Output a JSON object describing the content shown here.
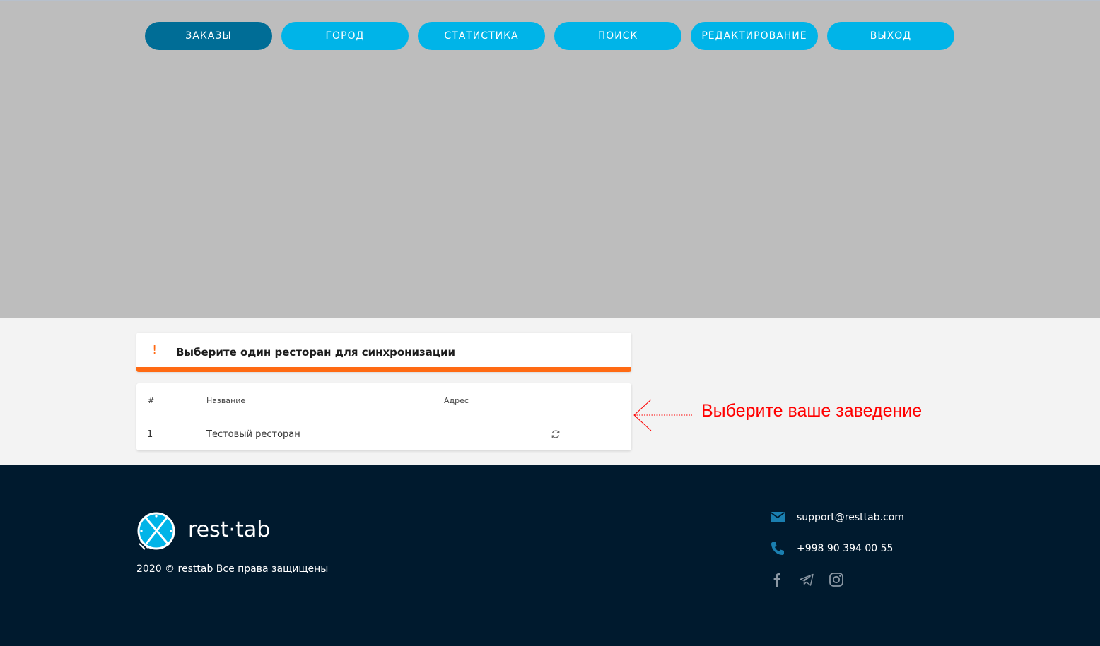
{
  "nav": {
    "items": [
      {
        "label": "ЗАКАЗЫ",
        "active": true
      },
      {
        "label": "ГОРОД",
        "active": false
      },
      {
        "label": "СТАТИСТИКА",
        "active": false
      },
      {
        "label": "ПОИСК",
        "active": false
      },
      {
        "label": "РЕДАКТИРОВАНИЕ",
        "active": false
      },
      {
        "label": "ВЫХОД",
        "active": false
      }
    ]
  },
  "alert": {
    "icon": "exclamation-icon",
    "symbol": "!",
    "text": "Выберите один ресторан для синхронизации"
  },
  "table": {
    "columns": [
      "#",
      "Название",
      "Адрес"
    ],
    "rows": [
      {
        "num": "1",
        "name": "Тестовый ресторан",
        "address": "",
        "action_icon": "sync-icon"
      }
    ]
  },
  "annotation": {
    "text": "Выберите ваше заведение",
    "color": "#ff0000"
  },
  "footer": {
    "logo_text": "rest·tab",
    "copyright": "2020 © resttab Все права защищены",
    "email": "support@resttab.com",
    "phone": "+998 90 394 00 55",
    "socials": [
      "facebook-icon",
      "telegram-icon",
      "instagram-icon"
    ]
  },
  "colors": {
    "header_bg": "#bdbdbd",
    "nav_button": "#00b4e8",
    "nav_button_active": "#006d96",
    "alert_accent": "#ff6a13",
    "footer_bg": "#001a2e",
    "footer_icon": "#1a7fb0"
  }
}
